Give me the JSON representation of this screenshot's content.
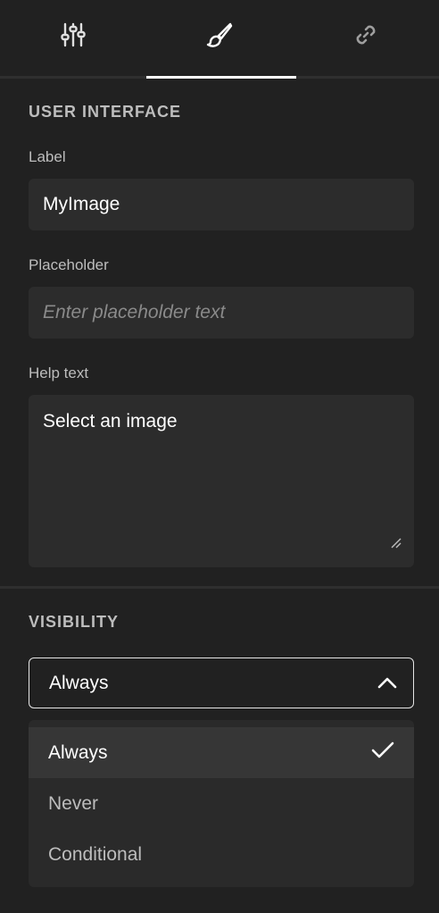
{
  "tabs": [
    {
      "icon": "sliders-icon"
    },
    {
      "icon": "paintbrush-icon",
      "active": true
    },
    {
      "icon": "link-icon"
    }
  ],
  "ui_section": {
    "title": "USER INTERFACE",
    "label_field": {
      "label": "Label",
      "value": "MyImage"
    },
    "placeholder_field": {
      "label": "Placeholder",
      "placeholder": "Enter placeholder text"
    },
    "help_field": {
      "label": "Help text",
      "value": "Select an image"
    }
  },
  "visibility_section": {
    "title": "VISIBILITY",
    "selected": "Always",
    "options": [
      "Always",
      "Never",
      "Conditional"
    ]
  },
  "colors": {
    "background": "#212121",
    "input_bg": "#2c2c2c",
    "muted_text": "#bdbdbd"
  }
}
